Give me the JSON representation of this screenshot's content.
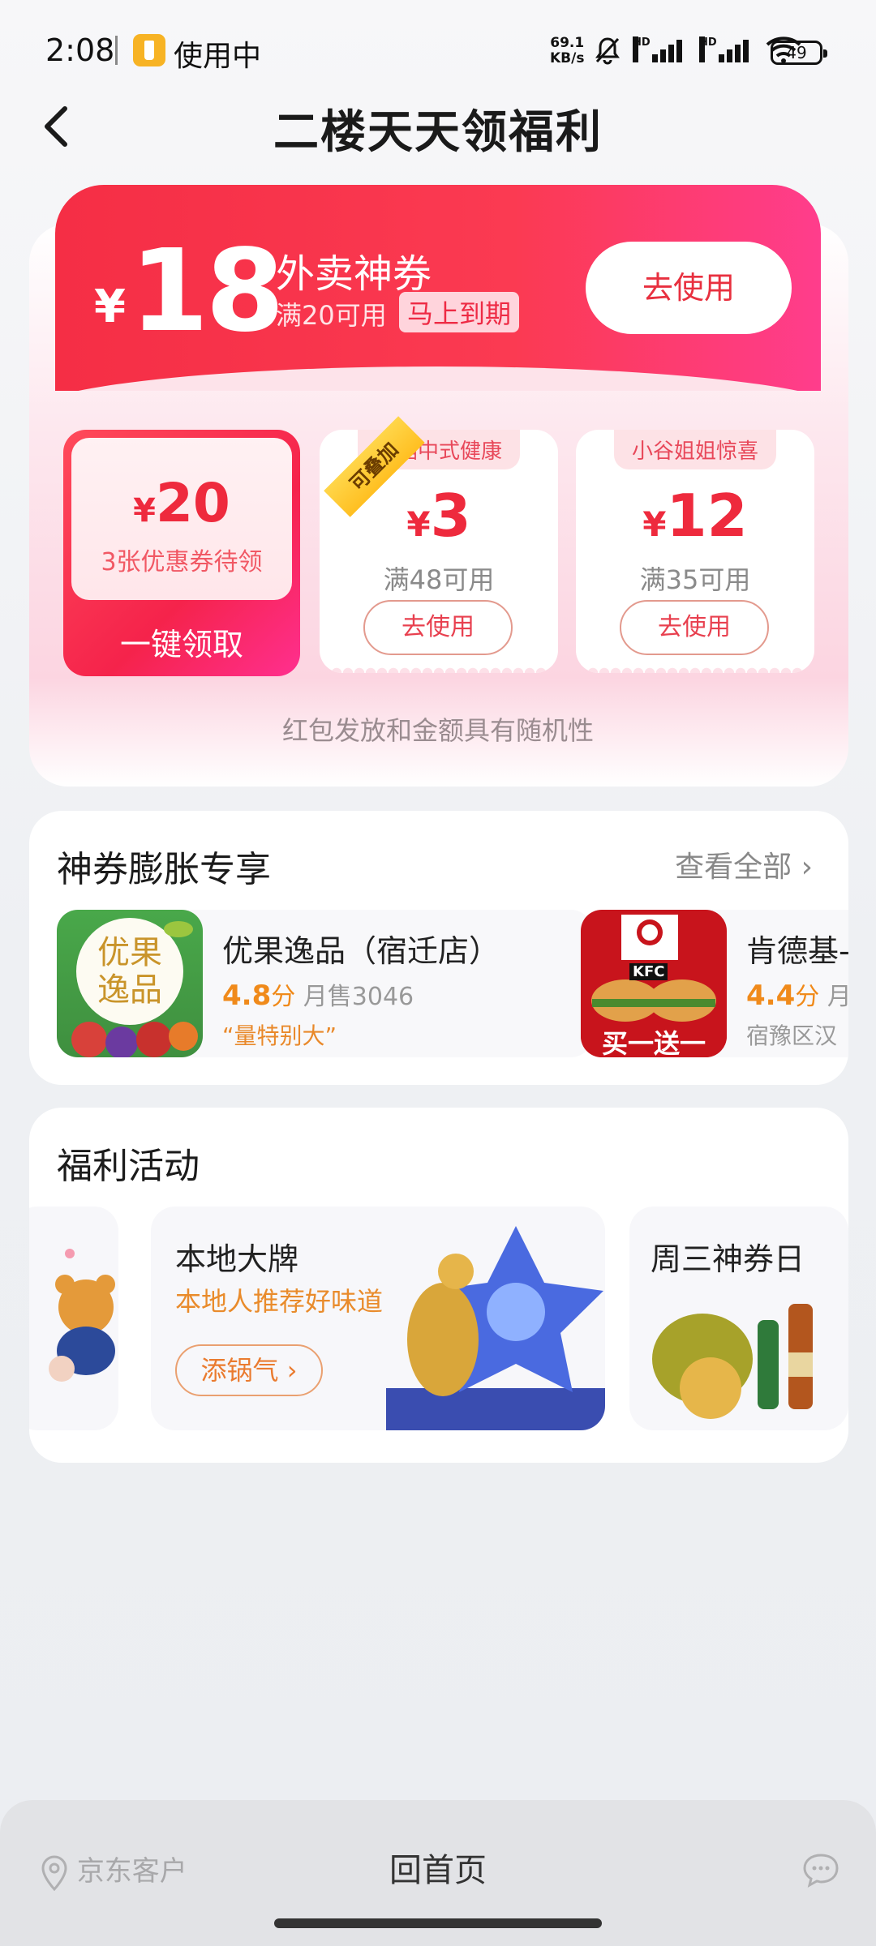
{
  "status_bar": {
    "time": "2:08",
    "app_badge": "使用中",
    "net_speed_value": "69.1",
    "net_speed_unit": "KB/s",
    "signal_label": "HD",
    "battery": "49"
  },
  "header": {
    "title": "二楼天天领福利"
  },
  "main_coupon": {
    "currency": "¥",
    "amount": "18",
    "name": "外卖神券",
    "condition": "满20可用",
    "tag": "马上到期",
    "use_label": "去使用"
  },
  "claim_card": {
    "amount": "20",
    "desc": "3张优惠券待领",
    "button": "一键领取"
  },
  "small_coupons": [
    {
      "shop": "麦稻中式健康",
      "amount": "3",
      "condition": "满48可用",
      "button": "去使用",
      "badge": "可叠加"
    },
    {
      "shop": "小谷姐姐惊喜",
      "amount": "12",
      "condition": "满35可用",
      "button": "去使用"
    }
  ],
  "random_note": "红包发放和金额具有随机性",
  "exclusive": {
    "title": "神券膨胀专享",
    "view_all": "查看全部",
    "shops": [
      {
        "name": "优果逸品（宿迁店）",
        "rating": "4.8",
        "rating_unit": "分",
        "sales": "月售3046",
        "quote": "“量特别大”",
        "logo_text": "优果逸品"
      },
      {
        "name": "肯德基-",
        "rating": "4.4",
        "rating_unit": "分",
        "sales": "月",
        "quote": "宿豫区汉",
        "img_text": "买一送一",
        "brand": "KFC"
      }
    ]
  },
  "activities": {
    "title": "福利活动",
    "items": [
      {
        "title": "本地大牌",
        "subtitle": "本地人推荐好味道",
        "button": "添锅气"
      },
      {
        "title": "周三神券日"
      }
    ]
  },
  "bottom_bar": {
    "location": "京东客户",
    "home": "回首页"
  },
  "colors": {
    "accent_red": "#f52e45",
    "accent_pink": "#ff3d8c",
    "orange": "#f08a1a"
  }
}
